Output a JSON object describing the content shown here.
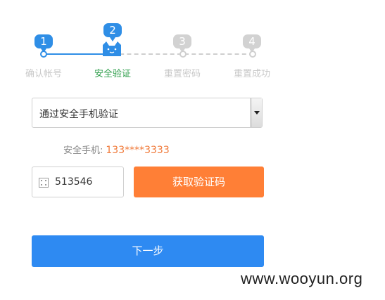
{
  "stepper": {
    "steps": [
      {
        "number": "1",
        "label": "确认帐号",
        "state": "done"
      },
      {
        "number": "2",
        "label": "安全验证",
        "state": "active"
      },
      {
        "number": "3",
        "label": "重置密码",
        "state": "todo"
      },
      {
        "number": "4",
        "label": "重置成功",
        "state": "todo"
      }
    ]
  },
  "verify_method": {
    "selected": "通过安全手机验证"
  },
  "phone": {
    "label": "安全手机:",
    "number": "133****3333"
  },
  "code": {
    "value": "513546",
    "icon": "grid-icon"
  },
  "buttons": {
    "get_code": "获取验证码",
    "next": "下一步"
  },
  "watermark": "www.wooyun.org",
  "colors": {
    "step_done": "#2f8ee6",
    "step_active_label": "#2e9e4b",
    "step_todo": "#cfcfcf",
    "get_code_bg": "#ff7f36",
    "next_bg": "#2e8af2",
    "phone_number": "#f07a3a"
  }
}
